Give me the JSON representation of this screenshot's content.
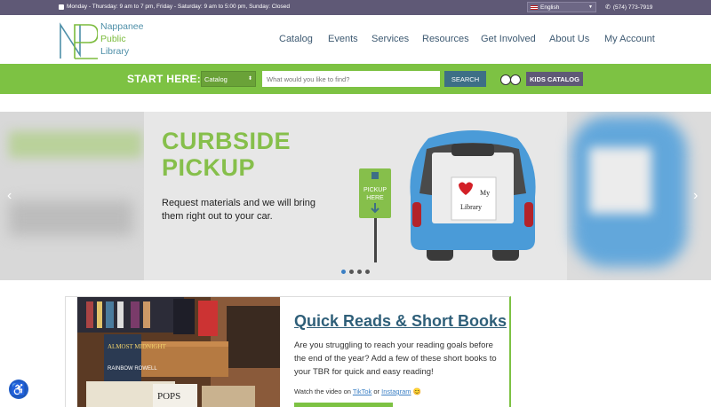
{
  "topbar": {
    "hours": "Monday - Thursday: 9 am to 7 pm, Friday - Saturday: 9 am to 5:00 pm, Sunday: Closed",
    "language": "English",
    "phone": "(574) 773-7919"
  },
  "logo": {
    "line1": "Nappanee",
    "line2": "Public",
    "line3": "Library"
  },
  "nav": [
    "Catalog",
    "Events",
    "Services",
    "Resources",
    "Get Involved",
    "About Us",
    "My Account"
  ],
  "search": {
    "start_label": "START HERE:",
    "scope": "Catalog",
    "placeholder": "What would you like to find?",
    "button": "SEARCH",
    "kids_label": "KIDS CATALOG"
  },
  "hero": {
    "title_line1": "CURBSIDE",
    "title_line2": "PICKUP",
    "subtitle": "Request materials and we will bring them right out to your car.",
    "sign_line1": "PICKUP",
    "sign_line2": "HERE",
    "bag_line1": "My",
    "bag_line2": "Library",
    "slides_count": 4,
    "active_slide": 1
  },
  "feature": {
    "title": "Quick Reads & Short Books",
    "body": "Are you struggling to reach your reading goals before the end of the year? Add a few of these short books to your TBR for quick and easy reading!",
    "video_prefix": "Watch the video on",
    "tiktok": "TikTok",
    "or": "or",
    "instagram": "Instagram",
    "book1": "ALMOST MIDNIGHT",
    "book1_author": "RAINBOW ROWELL",
    "book2": "POPS"
  },
  "colors": {
    "green": "#7dc243",
    "purple": "#5f5976",
    "blue": "#3d6f86",
    "car": "#4a9bd8"
  },
  "icons": [
    "calendar-icon",
    "flag-icon",
    "phone-icon",
    "chevron-down-icon",
    "kids-faces-icon",
    "arrow-left-icon",
    "arrow-right-icon",
    "accessibility-icon",
    "heart-icon"
  ]
}
